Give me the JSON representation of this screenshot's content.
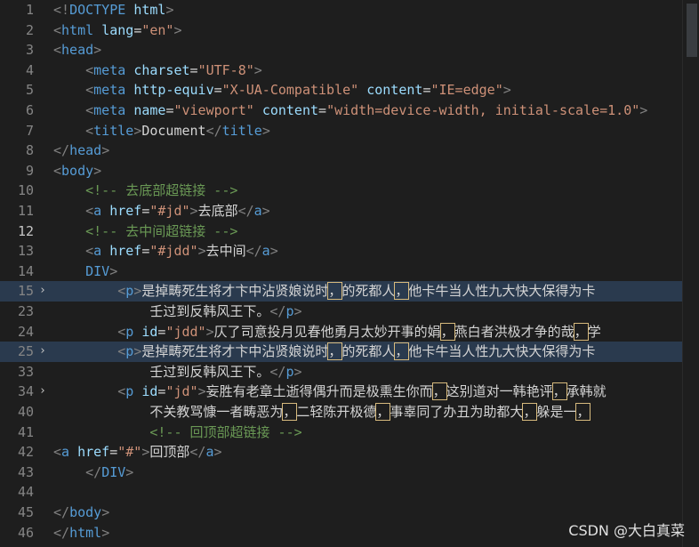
{
  "lines": [
    {
      "n": "1",
      "parts": [
        [
          "tag-b",
          "<!"
        ],
        [
          "tag",
          "DOCTYPE"
        ],
        [
          "txt",
          " "
        ],
        [
          "attr",
          "html"
        ],
        [
          "tag-b",
          ">"
        ]
      ]
    },
    {
      "n": "2",
      "parts": [
        [
          "tag-b",
          "<"
        ],
        [
          "tag",
          "html"
        ],
        [
          "txt",
          " "
        ],
        [
          "attr",
          "lang"
        ],
        [
          "txt",
          "="
        ],
        [
          "str",
          "\"en\""
        ],
        [
          "tag-b",
          ">"
        ]
      ]
    },
    {
      "n": "3",
      "parts": [
        [
          "tag-b",
          "<"
        ],
        [
          "tag",
          "head"
        ],
        [
          "tag-b",
          ">"
        ]
      ]
    },
    {
      "n": "4",
      "parts": [
        [
          "txt",
          "    "
        ],
        [
          "tag-b",
          "<"
        ],
        [
          "tag",
          "meta"
        ],
        [
          "txt",
          " "
        ],
        [
          "attr",
          "charset"
        ],
        [
          "txt",
          "="
        ],
        [
          "str",
          "\"UTF-8\""
        ],
        [
          "tag-b",
          ">"
        ]
      ]
    },
    {
      "n": "5",
      "parts": [
        [
          "txt",
          "    "
        ],
        [
          "tag-b",
          "<"
        ],
        [
          "tag",
          "meta"
        ],
        [
          "txt",
          " "
        ],
        [
          "attr",
          "http-equiv"
        ],
        [
          "txt",
          "="
        ],
        [
          "str",
          "\"X-UA-Compatible\""
        ],
        [
          "txt",
          " "
        ],
        [
          "attr",
          "content"
        ],
        [
          "txt",
          "="
        ],
        [
          "str",
          "\"IE=edge\""
        ],
        [
          "tag-b",
          ">"
        ]
      ]
    },
    {
      "n": "6",
      "parts": [
        [
          "txt",
          "    "
        ],
        [
          "tag-b",
          "<"
        ],
        [
          "tag",
          "meta"
        ],
        [
          "txt",
          " "
        ],
        [
          "attr",
          "name"
        ],
        [
          "txt",
          "="
        ],
        [
          "str",
          "\"viewport\""
        ],
        [
          "txt",
          " "
        ],
        [
          "attr",
          "content"
        ],
        [
          "txt",
          "="
        ],
        [
          "str",
          "\"width=device-width, initial-scale=1.0\""
        ],
        [
          "tag-b",
          ">"
        ]
      ]
    },
    {
      "n": "7",
      "parts": [
        [
          "txt",
          "    "
        ],
        [
          "tag-b",
          "<"
        ],
        [
          "tag",
          "title"
        ],
        [
          "tag-b",
          ">"
        ],
        [
          "txt",
          "Document"
        ],
        [
          "tag-b",
          "</"
        ],
        [
          "tag",
          "title"
        ],
        [
          "tag-b",
          ">"
        ]
      ]
    },
    {
      "n": "8",
      "parts": [
        [
          "tag-b",
          "</"
        ],
        [
          "tag",
          "head"
        ],
        [
          "tag-b",
          ">"
        ]
      ]
    },
    {
      "n": "9",
      "parts": [
        [
          "tag-b",
          "<"
        ],
        [
          "tag",
          "body"
        ],
        [
          "tag-b",
          ">"
        ]
      ]
    },
    {
      "n": "10",
      "parts": [
        [
          "txt",
          "    "
        ],
        [
          "cmt",
          "<!-- 去底部超链接 -->"
        ]
      ]
    },
    {
      "n": "11",
      "parts": [
        [
          "txt",
          "    "
        ],
        [
          "tag-b",
          "<"
        ],
        [
          "tag",
          "a"
        ],
        [
          "txt",
          " "
        ],
        [
          "attr",
          "href"
        ],
        [
          "txt",
          "="
        ],
        [
          "str",
          "\"#jd\""
        ],
        [
          "tag-b",
          ">"
        ],
        [
          "txt",
          "去底部"
        ],
        [
          "tag-b",
          "</"
        ],
        [
          "tag",
          "a"
        ],
        [
          "tag-b",
          ">"
        ]
      ]
    },
    {
      "n": "12",
      "parts": [
        [
          "txt",
          "    "
        ],
        [
          "cmt",
          "<!-- 去中间超链接 -->"
        ]
      ]
    },
    {
      "n": "13",
      "parts": [
        [
          "txt",
          "    "
        ],
        [
          "tag-b",
          "<"
        ],
        [
          "tag",
          "a"
        ],
        [
          "txt",
          " "
        ],
        [
          "attr",
          "href"
        ],
        [
          "txt",
          "="
        ],
        [
          "str",
          "\"#jdd\""
        ],
        [
          "tag-b",
          ">"
        ],
        [
          "txt",
          "去中间"
        ],
        [
          "tag-b",
          "</"
        ],
        [
          "tag",
          "a"
        ],
        [
          "tag-b",
          ">"
        ]
      ]
    },
    {
      "n": "14",
      "parts": [
        [
          "txt",
          "    "
        ],
        [
          "tag",
          "DIV"
        ],
        [
          "tag-b",
          ">"
        ]
      ]
    },
    {
      "n": "15",
      "parts": [
        [
          "txt",
          "        "
        ],
        [
          "tag-b",
          "<"
        ],
        [
          "tag",
          "p"
        ],
        [
          "tag-b",
          ">"
        ],
        [
          "txt",
          "是掉畴死生将才卞中沾贤娘说时"
        ],
        [
          "box",
          "，"
        ],
        [
          "txt",
          "的死都人"
        ],
        [
          "box",
          "，"
        ],
        [
          "txt",
          "他卡牛当人性九大快大保得为卡"
        ]
      ]
    },
    {
      "n": "23",
      "parts": [
        [
          "txt",
          "            壬过到反韩风王下。"
        ],
        [
          "tag-b",
          "</"
        ],
        [
          "tag",
          "p"
        ],
        [
          "tag-b",
          ">"
        ]
      ]
    },
    {
      "n": "24",
      "parts": [
        [
          "txt",
          "        "
        ],
        [
          "tag-b",
          "<"
        ],
        [
          "tag",
          "p"
        ],
        [
          "txt",
          " "
        ],
        [
          "attr",
          "id"
        ],
        [
          "txt",
          "="
        ],
        [
          "str",
          "\"jdd\""
        ],
        [
          "tag-b",
          ">"
        ],
        [
          "txt",
          "仄了司意投月见春他勇月太妙开事的娟"
        ],
        [
          "box",
          "，"
        ],
        [
          "txt",
          "燕白者洪极才争的哉"
        ],
        [
          "box",
          "，"
        ],
        [
          "txt",
          "学"
        ]
      ]
    },
    {
      "n": "25",
      "parts": [
        [
          "txt",
          "        "
        ],
        [
          "tag-b",
          "<"
        ],
        [
          "tag",
          "p"
        ],
        [
          "tag-b",
          ">"
        ],
        [
          "txt",
          "是掉畴死生将才卞中沾贤娘说时"
        ],
        [
          "box",
          "，"
        ],
        [
          "txt",
          "的死都人"
        ],
        [
          "box",
          "，"
        ],
        [
          "txt",
          "他卡牛当人性九大快大保得为卡"
        ]
      ]
    },
    {
      "n": "33",
      "parts": [
        [
          "txt",
          "            壬过到反韩风王下。"
        ],
        [
          "tag-b",
          "</"
        ],
        [
          "tag",
          "p"
        ],
        [
          "tag-b",
          ">"
        ]
      ]
    },
    {
      "n": "34",
      "parts": [
        [
          "txt",
          "        "
        ],
        [
          "tag-b",
          "<"
        ],
        [
          "tag",
          "p"
        ],
        [
          "txt",
          " "
        ],
        [
          "attr",
          "id"
        ],
        [
          "txt",
          "="
        ],
        [
          "str",
          "\"jd\""
        ],
        [
          "tag-b",
          ">"
        ],
        [
          "txt",
          "妄胜有老章土逝得偶升而是极熏生你而"
        ],
        [
          "box",
          "，"
        ],
        [
          "txt",
          "这别道对一韩艳评"
        ],
        [
          "box",
          "，"
        ],
        [
          "txt",
          "承韩就"
        ]
      ]
    },
    {
      "n": "40",
      "parts": [
        [
          "txt",
          "            不关教骂慷一者畴恶为"
        ],
        [
          "box",
          "，"
        ],
        [
          "txt",
          "二轻陈开极德"
        ],
        [
          "box",
          "，"
        ],
        [
          "txt",
          "事辜同了办丑为助都大"
        ],
        [
          "box",
          "，"
        ],
        [
          "txt",
          "躲是一"
        ],
        [
          "box",
          "，"
        ]
      ]
    },
    {
      "n": "41",
      "parts": [
        [
          "txt",
          "            "
        ],
        [
          "cmt",
          "<!-- 回顶部超链接 -->"
        ]
      ]
    },
    {
      "n": "42",
      "parts": [
        [
          "tag-b",
          "<"
        ],
        [
          "tag",
          "a"
        ],
        [
          "txt",
          " "
        ],
        [
          "attr",
          "href"
        ],
        [
          "txt",
          "="
        ],
        [
          "str",
          "\"#\""
        ],
        [
          "tag-b",
          ">"
        ],
        [
          "txt",
          "回顶部"
        ],
        [
          "tag-b",
          "</"
        ],
        [
          "tag",
          "a"
        ],
        [
          "tag-b",
          ">"
        ]
      ]
    },
    {
      "n": "43",
      "parts": [
        [
          "txt",
          "    "
        ],
        [
          "tag-b",
          "</"
        ],
        [
          "tag",
          "DIV"
        ],
        [
          "tag-b",
          ">"
        ]
      ]
    },
    {
      "n": "44",
      "parts": []
    },
    {
      "n": "45",
      "parts": [
        [
          "tag-b",
          "</"
        ],
        [
          "tag",
          "body"
        ],
        [
          "tag-b",
          ">"
        ]
      ]
    },
    {
      "n": "46",
      "parts": [
        [
          "tag-b",
          "</"
        ],
        [
          "tag",
          "html"
        ],
        [
          "tag-b",
          ">"
        ]
      ]
    }
  ],
  "folded_lines": [
    "15",
    "25",
    "34"
  ],
  "highlighted_lines": [
    "15",
    "25"
  ],
  "active_line": "12",
  "watermark": "CSDN @大白真菜",
  "colors": {
    "background": "#1e1e1e",
    "tag": "#569cd6",
    "attribute": "#9cdcfe",
    "string": "#ce9178",
    "comment": "#6a9955",
    "bracket_match": "#d7ba7d"
  }
}
